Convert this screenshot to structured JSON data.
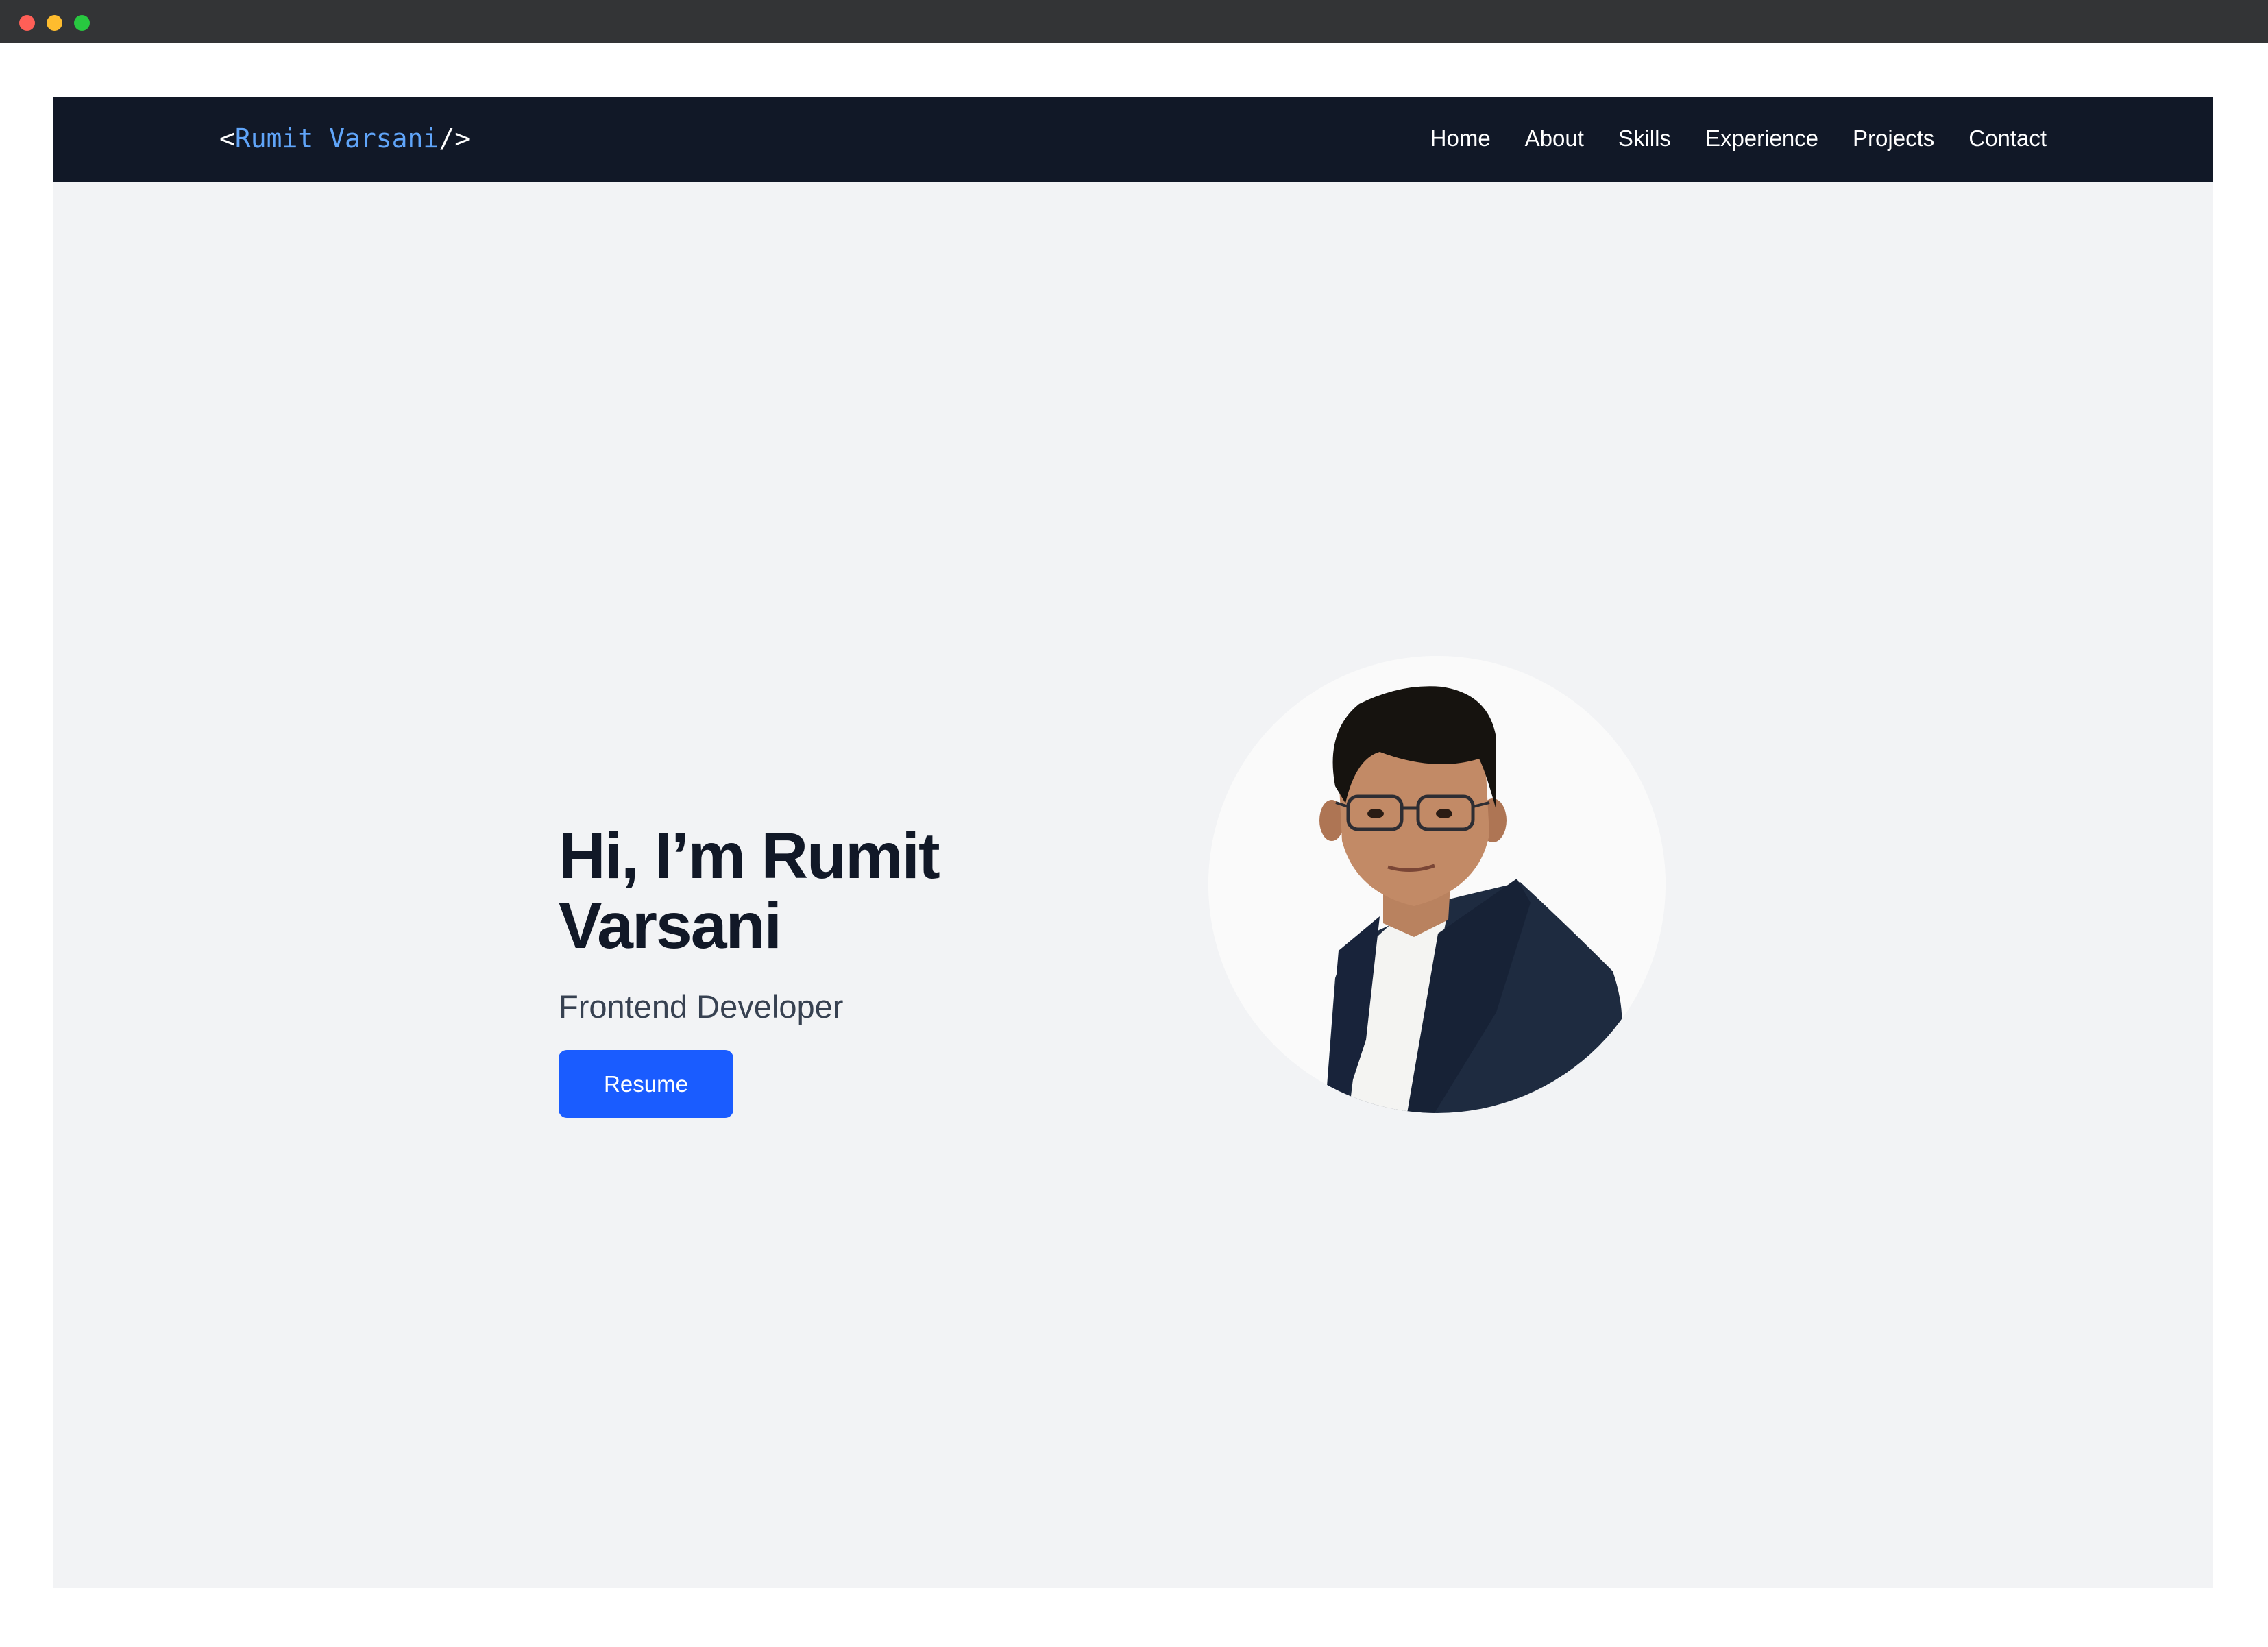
{
  "window": {
    "controls": [
      "close",
      "minimize",
      "maximize"
    ],
    "colors": {
      "close": "#ff5f57",
      "minimize": "#febc2e",
      "maximize": "#28c840",
      "chrome": "#333436"
    }
  },
  "navbar": {
    "logo": {
      "prefix": "<",
      "name": "Rumit Varsani",
      "suffix": "/>"
    },
    "links": [
      {
        "label": "Home"
      },
      {
        "label": "About"
      },
      {
        "label": "Skills"
      },
      {
        "label": "Experience"
      },
      {
        "label": "Projects"
      },
      {
        "label": "Contact"
      }
    ],
    "colors": {
      "background": "#111827",
      "logo_accent": "#60a5fa",
      "text": "#ffffff"
    }
  },
  "hero": {
    "title": "Hi, I’m Rumit Varsani",
    "subtitle": "Frontend Developer",
    "button_label": "Resume",
    "colors": {
      "background": "#f2f3f5",
      "title": "#111827",
      "subtitle": "#374151",
      "button": "#1a5cff"
    }
  },
  "avatar": {
    "image": "profile-photo"
  }
}
